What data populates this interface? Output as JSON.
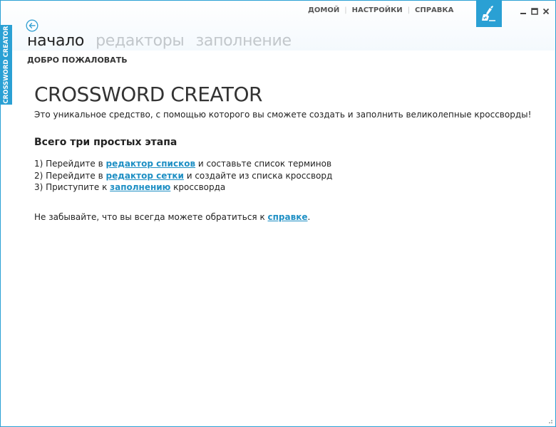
{
  "window": {
    "side_tab_label": "CROSSWORD CREATOR",
    "accent": "#2aa0d4",
    "controls": [
      "minimize-icon",
      "maximize-icon",
      "close-icon"
    ]
  },
  "topnav": {
    "items": [
      {
        "label": "ДОМОЙ"
      },
      {
        "label": "НАСТРОЙКИ"
      },
      {
        "label": "СПРАВКА"
      }
    ],
    "separator": "|",
    "brush_icon": "brush-icon"
  },
  "back_icon": "back-arrow-icon",
  "tabs": [
    {
      "label": "начало",
      "active": true
    },
    {
      "label": "редакторы",
      "active": false
    },
    {
      "label": "заполнение",
      "active": false
    }
  ],
  "subtitle": "ДОБРО ПОЖАЛОВАТЬ",
  "content": {
    "title": "CROSSWORD CREATOR",
    "intro": "Это уникальное средство, с помощью которого вы сможете создать и заполнить великолепные кроссворды!",
    "steps_heading": "Всего три простых этапа",
    "steps": [
      {
        "prefix": "1) Перейдите в ",
        "link": "редактор списков",
        "suffix": " и составьте список терминов"
      },
      {
        "prefix": "2) Перейдите в ",
        "link": "редактор сетки",
        "suffix": " и создайте из списка кроссворд"
      },
      {
        "prefix": "3) Приступите к ",
        "link": "заполнению",
        "suffix": " кроссворда"
      }
    ],
    "footer": {
      "prefix": "Не забывайте, что вы всегда можете обратиться к ",
      "link": "справке",
      "suffix": "."
    },
    "link_color": "#1e8fc4"
  }
}
